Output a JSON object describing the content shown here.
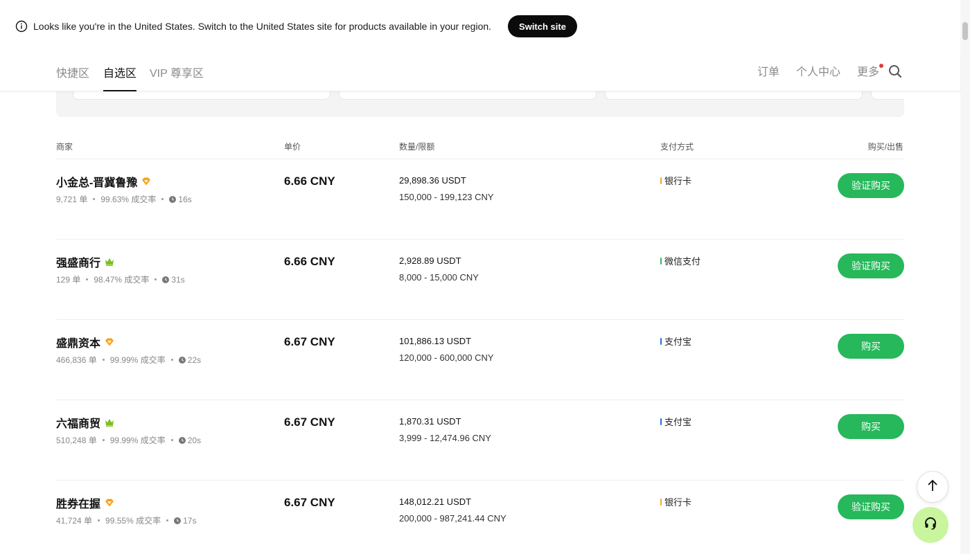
{
  "banner": {
    "text": "Looks like you're in the United States. Switch to the United States site for products available in your region.",
    "switch_label": "Switch site"
  },
  "nav": {
    "tabs": [
      {
        "label": "快捷区"
      },
      {
        "label": "自选区"
      },
      {
        "label": "VIP 尊享区"
      }
    ],
    "active_tab": "自选区",
    "orders": "订单",
    "profile": "个人中心",
    "more": "更多"
  },
  "table": {
    "headers": {
      "merchant": "商家",
      "price": "单价",
      "quantity": "数量/限额",
      "payment": "支付方式",
      "action": "购买/出售"
    },
    "rows": [
      {
        "merchant": "小金总-晋冀鲁豫",
        "badge": "diamond",
        "orders": "9,721 单",
        "completion": "99.63% 成交率",
        "time": "16s",
        "price": "6.66 CNY",
        "quantity": "29,898.36 USDT",
        "limit": "150,000 - 199,123 CNY",
        "payment": "银行卡",
        "payment_color": "#f5a623",
        "action": "验证购买"
      },
      {
        "merchant": "强盛商行",
        "badge": "crown",
        "orders": "129 单",
        "completion": "98.47% 成交率",
        "time": "31s",
        "price": "6.66 CNY",
        "quantity": "2,928.89 USDT",
        "limit": "8,000 - 15,000 CNY",
        "payment": "微信支付",
        "payment_color": "#2fb45a",
        "action": "验证购买"
      },
      {
        "merchant": "盛鼎资本",
        "badge": "diamond",
        "orders": "466,836 单",
        "completion": "99.99% 成交率",
        "time": "22s",
        "price": "6.67 CNY",
        "quantity": "101,886.13 USDT",
        "limit": "120,000 - 600,000 CNY",
        "payment": "支付宝",
        "payment_color": "#1e6fe0",
        "action": "购买"
      },
      {
        "merchant": "六福商贸",
        "badge": "crown",
        "orders": "510,248 单",
        "completion": "99.99% 成交率",
        "time": "20s",
        "price": "6.67 CNY",
        "quantity": "1,870.31 USDT",
        "limit": "3,999 - 12,474.96 CNY",
        "payment": "支付宝",
        "payment_color": "#1e6fe0",
        "action": "购买"
      },
      {
        "merchant": "胜券在握",
        "badge": "diamond",
        "orders": "41,724 单",
        "completion": "99.55% 成交率",
        "time": "17s",
        "price": "6.67 CNY",
        "quantity": "148,012.21 USDT",
        "limit": "200,000 - 987,241.44 CNY",
        "payment": "银行卡",
        "payment_color": "#f5a623",
        "action": "验证购买"
      }
    ]
  },
  "colors": {
    "buy_button": "#26b85a",
    "diamond_badge": "#f7a21b",
    "crown_badge": "#7cc01f",
    "support_button": "#c9f59e"
  }
}
